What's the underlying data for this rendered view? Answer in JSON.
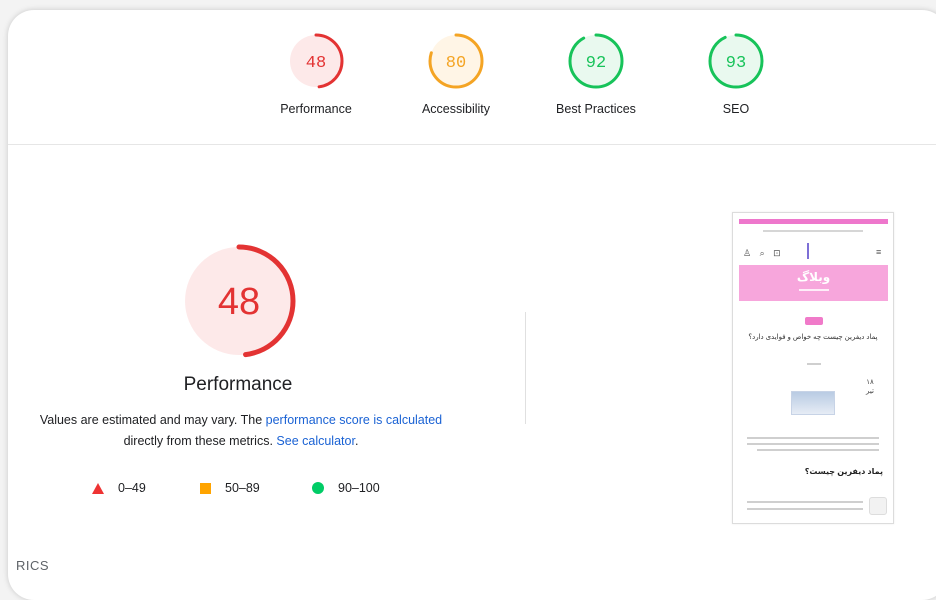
{
  "summary": {
    "categories": [
      {
        "label": "Performance",
        "score": "48",
        "value": 48,
        "color": "#e33333",
        "bg": "#fde9e9"
      },
      {
        "label": "Accessibility",
        "score": "80",
        "value": 80,
        "color": "#f4a424",
        "bg": "#fff5e6"
      },
      {
        "label": "Best Practices",
        "score": "92",
        "value": 92,
        "color": "#17c35a",
        "bg": "#e9f9ef"
      },
      {
        "label": "SEO",
        "score": "93",
        "value": 93,
        "color": "#17c35a",
        "bg": "#e9f9ef"
      }
    ]
  },
  "main": {
    "score": "48",
    "value": 48,
    "title": "Performance",
    "desc_prefix": "Values are estimated and may vary. The ",
    "desc_link": "performance score is calculated",
    "desc_middle": "directly from these metrics. ",
    "desc_link2": "See calculator",
    "desc_suffix": "."
  },
  "legend": {
    "fail": "0–49",
    "average": "50–89",
    "pass": "90–100",
    "colors": {
      "fail": "#e33333",
      "average": "#ffa400",
      "pass": "#00cc66"
    }
  },
  "metrics_heading_partial": "RICS",
  "thumbnail": {
    "banner_title": "وبلاگ",
    "post_title": "پماد دیفرین چیست چه خواص و فوایدی دارد؟",
    "date": "۱۸ تیر",
    "heading": "پماد دیفرین چیست؟"
  }
}
